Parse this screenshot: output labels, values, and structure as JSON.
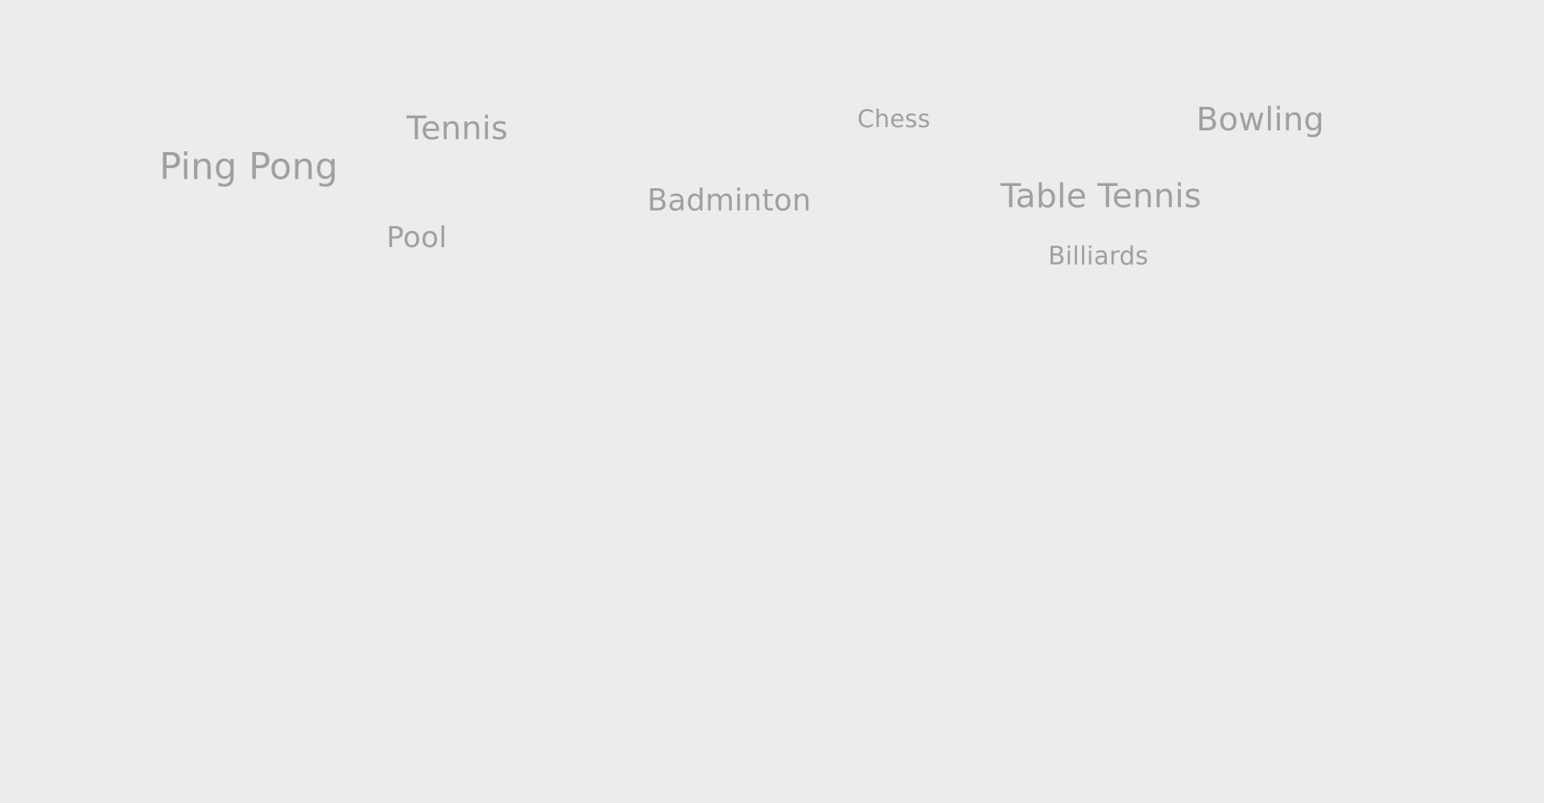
{
  "word_cloud": {
    "words": [
      {
        "text": "Ping Pong"
      },
      {
        "text": "Tennis"
      },
      {
        "text": "Pool"
      },
      {
        "text": "Badminton"
      },
      {
        "text": "Chess"
      },
      {
        "text": "Table Tennis"
      },
      {
        "text": "Billiards"
      },
      {
        "text": "Bowling"
      }
    ],
    "text_color": "#a0a0a0",
    "background_color": "#ececec"
  }
}
